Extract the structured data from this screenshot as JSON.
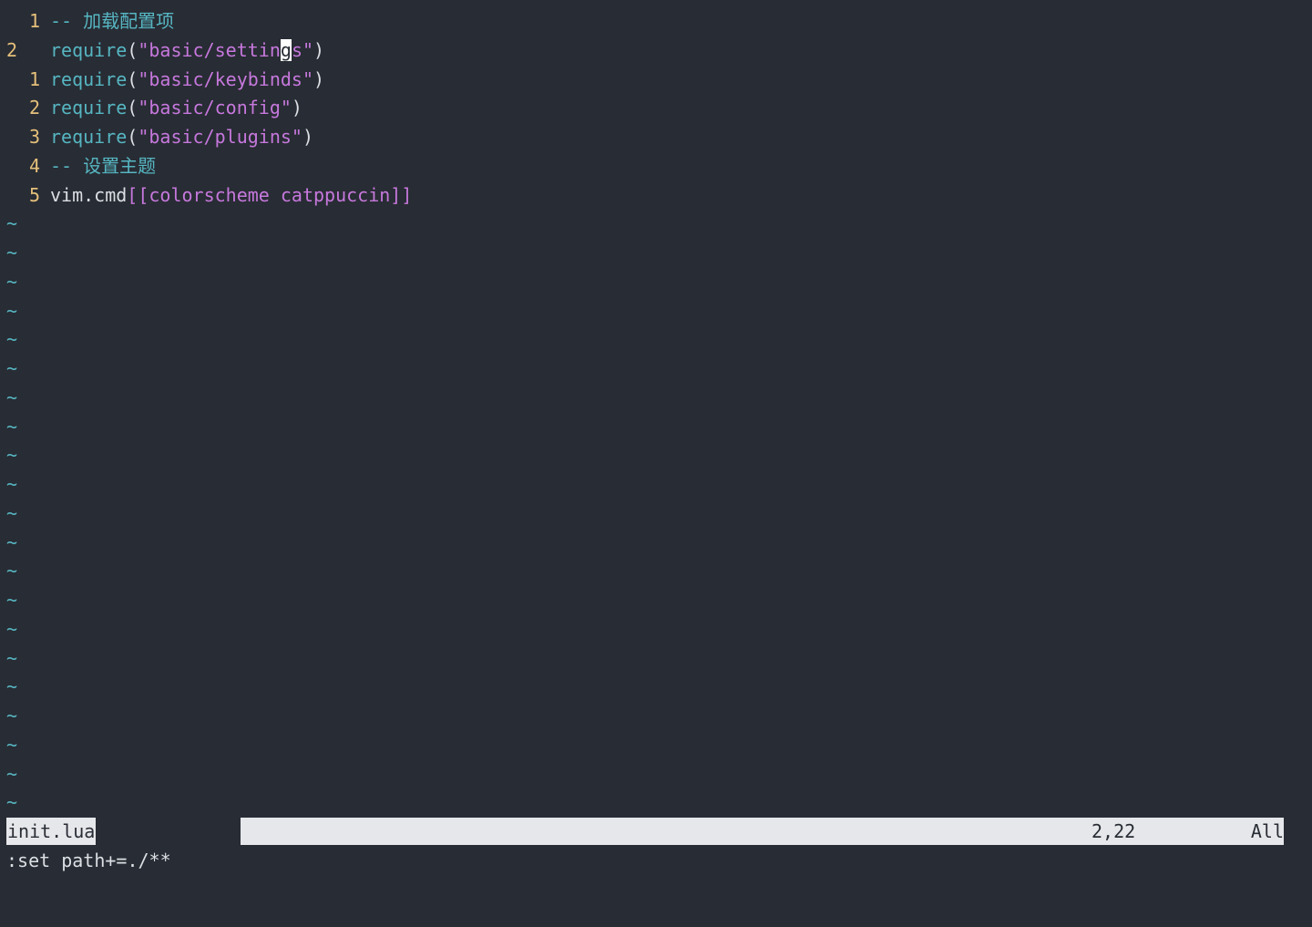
{
  "lines": [
    {
      "num": "1",
      "parts": [
        {
          "t": "-- 加载配置项",
          "c": "comment"
        }
      ]
    },
    {
      "num": "2",
      "current": true,
      "parts": [
        {
          "t": "require",
          "c": "fn"
        },
        {
          "t": "(",
          "c": "punc"
        },
        {
          "t": "\"basic/settin",
          "c": "str"
        },
        {
          "t": "g",
          "c": "cursor"
        },
        {
          "t": "s\"",
          "c": "str"
        },
        {
          "t": ")",
          "c": "punc"
        }
      ]
    },
    {
      "num": "1",
      "parts": [
        {
          "t": "require",
          "c": "fn"
        },
        {
          "t": "(",
          "c": "punc"
        },
        {
          "t": "\"basic/keybinds\"",
          "c": "str"
        },
        {
          "t": ")",
          "c": "punc"
        }
      ]
    },
    {
      "num": "2",
      "parts": [
        {
          "t": "require",
          "c": "fn"
        },
        {
          "t": "(",
          "c": "punc"
        },
        {
          "t": "\"basic/config\"",
          "c": "str"
        },
        {
          "t": ")",
          "c": "punc"
        }
      ]
    },
    {
      "num": "3",
      "parts": [
        {
          "t": "require",
          "c": "fn"
        },
        {
          "t": "(",
          "c": "punc"
        },
        {
          "t": "\"basic/plugins\"",
          "c": "str"
        },
        {
          "t": ")",
          "c": "punc"
        }
      ]
    },
    {
      "num": "4",
      "parts": [
        {
          "t": "-- 设置主题",
          "c": "comment"
        }
      ]
    },
    {
      "num": "5",
      "parts": [
        {
          "t": "vim.cmd",
          "c": "plain"
        },
        {
          "t": "[[colorscheme catppuccin]]",
          "c": "str"
        }
      ]
    }
  ],
  "tilde_char": "~",
  "tilde_count": 21,
  "status": {
    "filename": "init.lua",
    "position": "2,22",
    "percent": "All"
  },
  "cmdline": ":set path+=./**",
  "colors": {
    "background": "#282c34",
    "line_number": "#e5c07b",
    "comment": "#56b6c2",
    "function": "#56b6c2",
    "string": "#c678dd",
    "foreground": "#dcdfe4",
    "statusline_bg": "#e6e7ea"
  }
}
